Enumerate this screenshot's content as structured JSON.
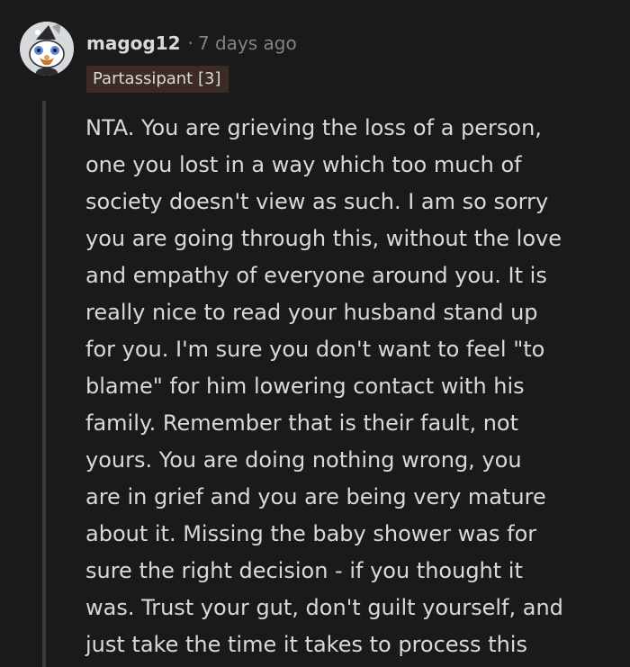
{
  "comment": {
    "username": "magog12",
    "separator": "·",
    "timestamp": "7 days ago",
    "flair": "Partassipant [3]",
    "avatar_icon": "snoo-avatar-icon",
    "body": "NTA. You are grieving the loss of a person,\none you lost in a way which too much of\nsociety doesn't view as such. I am so sorry\nyou are going through this, without the love\nand empathy of everyone around you. It is\nreally nice to read your husband stand up\nfor you. I'm sure you don't want to feel \"to\nblame\" for him lowering contact with his\nfamily. Remember that is their fault, not\nyours. You are doing nothing wrong, you\nare in grief and you are being very mature\nabout it. Missing the baby shower was for\nsure the right decision - if you thought it\nwas. Trust your gut, don't guilt yourself, and\njust take the time it takes to process this"
  },
  "colors": {
    "background": "#1a1a1b",
    "text": "#d7dadc",
    "muted": "#818384",
    "flair_bg": "#3b2b24",
    "thread_line": "#3a3a3c"
  }
}
